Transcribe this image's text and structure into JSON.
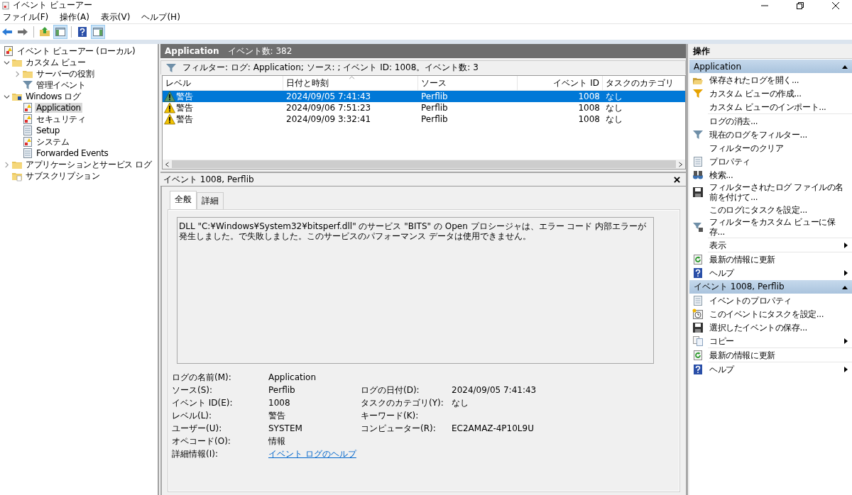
{
  "window": {
    "title": "イベント ビューアー"
  },
  "menu": [
    "ファイル(F)",
    "操作(A)",
    "表示(V)",
    "ヘルプ(H)"
  ],
  "toolbar": [
    {
      "kind": "back",
      "pressed": false
    },
    {
      "kind": "forward",
      "pressed": false
    },
    {
      "kind": "up-folder",
      "pressed": false
    },
    {
      "kind": "pane",
      "pressed": true
    },
    {
      "kind": "help",
      "pressed": false
    },
    {
      "kind": "pane2",
      "pressed": true
    }
  ],
  "tree": [
    {
      "label": "イベント ビューアー (ローカル)",
      "kind": "viewer",
      "selected": false,
      "children": [
        {
          "label": "カスタム ビュー",
          "kind": "folder",
          "selected": false,
          "expanded": true,
          "children": [
            {
              "label": "サーバーの役割",
              "kind": "folder",
              "selected": false,
              "expanded": false
            },
            {
              "label": "管理イベント",
              "kind": "funnel",
              "selected": false
            }
          ]
        },
        {
          "label": "Windows ログ",
          "kind": "winlog",
          "selected": false,
          "expanded": true,
          "children": [
            {
              "label": "Application",
              "kind": "log",
              "selected": true
            },
            {
              "label": "セキュリティ",
              "kind": "log",
              "selected": false
            },
            {
              "label": "Setup",
              "kind": "doc",
              "selected": false
            },
            {
              "label": "システム",
              "kind": "log",
              "selected": false
            },
            {
              "label": "Forwarded Events",
              "kind": "doc",
              "selected": false
            }
          ]
        },
        {
          "label": "アプリケーションとサービス ログ",
          "kind": "folder",
          "selected": false,
          "expanded": false
        },
        {
          "label": "サブスクリプション",
          "kind": "subscription",
          "selected": false
        }
      ]
    }
  ],
  "log_header": {
    "name": "Application",
    "count": "イベント数: 382"
  },
  "filter": "フィルター: ログ: Application; ソース: ; イベント ID: 1008。イベント数: 3",
  "table": {
    "columns": [
      "レベル",
      "日付と時刻",
      "ソース",
      "イベント ID",
      "タスクのカテゴリ"
    ],
    "rows": [
      {
        "kind": "warning",
        "level": "警告",
        "date": "2024/09/05 7:41:43",
        "source": "Perflib",
        "event_id": "1008",
        "category": "なし",
        "selected": true
      },
      {
        "kind": "warning",
        "level": "警告",
        "date": "2024/09/06 7:51:23",
        "source": "Perflib",
        "event_id": "1008",
        "category": "なし",
        "selected": false
      },
      {
        "kind": "warning",
        "level": "警告",
        "date": "2024/09/09 3:32:41",
        "source": "Perflib",
        "event_id": "1008",
        "category": "なし",
        "selected": false
      }
    ]
  },
  "details": {
    "title": "イベント 1008, Perflib",
    "tabs": [
      {
        "label": "全般",
        "selected": true
      },
      {
        "label": "詳細",
        "selected": false
      }
    ],
    "message": "DLL \"C:¥Windows¥System32¥bitsperf.dll\" のサービス \"BITS\" の Open プロシージャは、エラー コード 内部エラーが発生しました。で失敗しました。このサービスのパフォーマンス データは使用できません。",
    "fields": [
      {
        "label": "ログの名前(M):",
        "value": "Application"
      },
      {
        "label": "ソース(S):",
        "value": "Perflib",
        "label_2": "ログの日付(D):",
        "value_2": "2024/09/05 7:41:43"
      },
      {
        "label": "イベント ID(E):",
        "value": "1008",
        "label_2": "タスクのカテゴリ(Y):",
        "value_2": "なし"
      },
      {
        "label": "レベル(L):",
        "value": "警告",
        "label_2": "キーワード(K):"
      },
      {
        "label": "ユーザー(U):",
        "value": "SYSTEM",
        "label_2": "コンピューター(R):",
        "value_2": "EC2AMAZ-4P10L9U"
      },
      {
        "label": "オペコード(O):",
        "value": "情報"
      },
      {
        "label": "詳細情報(I):",
        "link": "イベント ログのヘルプ"
      }
    ]
  },
  "actions": {
    "title": "操作",
    "sections": [
      {
        "title": "Application",
        "expanded": true,
        "items": [
          {
            "label": "保存されたログを開く...",
            "kind": "open-folder"
          },
          {
            "label": "カスタム ビューの作成...",
            "kind": "funnel-star"
          },
          {
            "label": "カスタム ビューのインポート...",
            "kind": "none"
          },
          {
            "label": "ログの消去...",
            "kind": "none",
            "divider": true
          },
          {
            "label": "現在のログをフィルター...",
            "kind": "funnel"
          },
          {
            "label": "フィルターのクリア",
            "kind": "none"
          },
          {
            "label": "プロパティ",
            "kind": "properties"
          },
          {
            "label": "検索...",
            "kind": "binoculars"
          },
          {
            "label": "フィルターされたログ ファイルの名前を付けて...",
            "kind": "save"
          },
          {
            "label": "このログにタスクを設定...",
            "kind": "none"
          },
          {
            "label": "フィルターをカスタム ビューに保存...",
            "kind": "funnel-save"
          },
          {
            "label": "表示",
            "kind": "none",
            "divider": true,
            "submenu": true
          },
          {
            "label": "最新の情報に更新",
            "kind": "refresh",
            "divider": true
          },
          {
            "label": "ヘルプ",
            "kind": "help",
            "submenu": true
          }
        ]
      },
      {
        "title": "イベント 1008, Perflib",
        "expanded": true,
        "items": [
          {
            "label": "イベントのプロパティ",
            "kind": "properties"
          },
          {
            "label": "このイベントにタスクを設定...",
            "kind": "task"
          },
          {
            "label": "選択したイベントの保存...",
            "kind": "save"
          },
          {
            "label": "コピー",
            "kind": "copy",
            "submenu": true
          },
          {
            "label": "最新の情報に更新",
            "kind": "refresh",
            "divider": true
          },
          {
            "label": "ヘルプ",
            "kind": "help",
            "divider": true,
            "submenu": true
          }
        ]
      }
    ]
  }
}
